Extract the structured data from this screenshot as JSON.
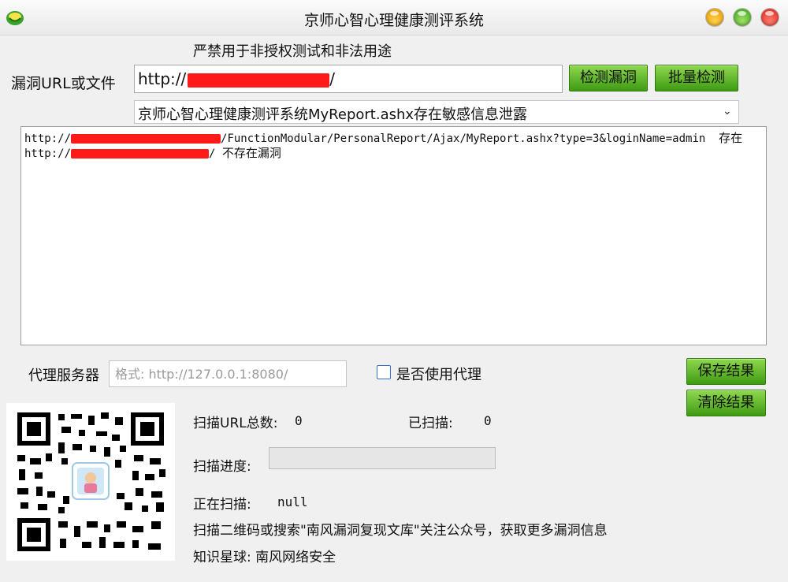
{
  "window": {
    "title": "京师心智心理健康测评系统",
    "icon": "app-logo-icon"
  },
  "warning": "严禁用于非授权测试和非法用途",
  "url": {
    "label": "漏洞URL或文件",
    "value_prefix": "http://",
    "value_suffix": "/"
  },
  "buttons": {
    "detect": "检测漏洞",
    "batch": "批量检测",
    "save": "保存结果",
    "clear": "清除结果"
  },
  "vuln_select": {
    "selected": "京师心智心理健康测评系统MyReport.ashx存在敏感信息泄露"
  },
  "results": [
    {
      "prefix": "http://",
      "suffix": "/FunctionModular/PersonalReport/Ajax/MyReport.ashx?type=3&loginName=admin",
      "status": "存在"
    },
    {
      "prefix": "http://",
      "suffix": "/",
      "status": "不存在漏洞"
    }
  ],
  "proxy": {
    "label": "代理服务器",
    "placeholder": "格式: http://127.0.0.1:8080/",
    "use_label": "是否使用代理",
    "use_checked": false
  },
  "stats": {
    "total_label": "扫描URL总数:",
    "total_value": "0",
    "scanned_label": "已扫描:",
    "scanned_value": "0",
    "progress_label": "扫描进度:",
    "progress_percent": 0,
    "current_label": "正在扫描:",
    "current_value": "null"
  },
  "footer": {
    "qr_note": "扫描二维码或搜索\"南风漏洞复现文库\"关注公众号，获取更多漏洞信息",
    "planet": "知识星球: 南风网络安全"
  },
  "colors": {
    "button_green": "#4caf1e",
    "redaction": "#ff1a1a"
  }
}
